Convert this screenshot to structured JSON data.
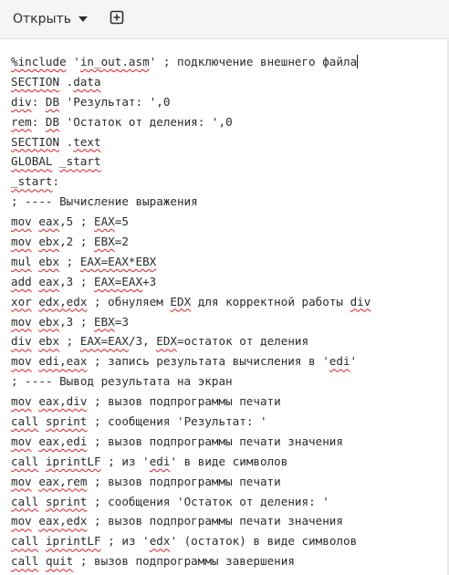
{
  "header": {
    "open_label": "Открыть",
    "open_icon": "chevron-down-icon",
    "new_tab_icon": "new-tab-plus-icon"
  },
  "editor": {
    "lines": [
      [
        {
          "t": "%include",
          "s": 1
        },
        {
          "t": " '"
        },
        {
          "t": "in_out.asm",
          "s": 1
        },
        {
          "t": "' ; подключение внешнего файла"
        }
      ],
      [
        {
          "t": "SECTION",
          "s": 1
        },
        {
          "t": " ."
        },
        {
          "t": "data",
          "s": 1
        }
      ],
      [
        {
          "t": "div",
          "s": 1
        },
        {
          "t": ": "
        },
        {
          "t": "DB",
          "s": 1
        },
        {
          "t": " 'Результат: ',0"
        }
      ],
      [
        {
          "t": "rem",
          "s": 1
        },
        {
          "t": ": "
        },
        {
          "t": "DB",
          "s": 1
        },
        {
          "t": " 'Остаток от деления: ',0"
        }
      ],
      [
        {
          "t": "SECTION",
          "s": 1
        },
        {
          "t": " ."
        },
        {
          "t": "text",
          "s": 1
        }
      ],
      [
        {
          "t": "GLOBAL",
          "s": 1
        },
        {
          "t": " "
        },
        {
          "t": "_start",
          "s": 1
        }
      ],
      [
        {
          "t": "_start",
          "s": 1
        },
        {
          "t": ":"
        }
      ],
      [
        {
          "t": "; ---- Вычисление выражения"
        }
      ],
      [
        {
          "t": "mov",
          "s": 1
        },
        {
          "t": " "
        },
        {
          "t": "eax",
          "s": 1
        },
        {
          "t": ",5 ; "
        },
        {
          "t": "EAX",
          "s": 1
        },
        {
          "t": "=5"
        }
      ],
      [
        {
          "t": "mov",
          "s": 1
        },
        {
          "t": " "
        },
        {
          "t": "ebx",
          "s": 1
        },
        {
          "t": ",2 ; "
        },
        {
          "t": "EBX",
          "s": 1
        },
        {
          "t": "=2"
        }
      ],
      [
        {
          "t": "mul",
          "s": 1
        },
        {
          "t": " "
        },
        {
          "t": "ebx",
          "s": 1
        },
        {
          "t": " ; "
        },
        {
          "t": "EAX=EAX*EBX",
          "s": 1
        }
      ],
      [
        {
          "t": "add",
          "s": 1
        },
        {
          "t": " "
        },
        {
          "t": "eax",
          "s": 1
        },
        {
          "t": ",3 ; "
        },
        {
          "t": "EAX=EAX",
          "s": 1
        },
        {
          "t": "+3"
        }
      ],
      [
        {
          "t": "xor",
          "s": 1
        },
        {
          "t": " "
        },
        {
          "t": "edx,edx",
          "s": 1
        },
        {
          "t": " ; обнуляем "
        },
        {
          "t": "EDX",
          "s": 1
        },
        {
          "t": " для корректной работы "
        },
        {
          "t": "div",
          "s": 1
        }
      ],
      [
        {
          "t": "mov",
          "s": 1
        },
        {
          "t": " "
        },
        {
          "t": "ebx",
          "s": 1
        },
        {
          "t": ",3 ; "
        },
        {
          "t": "EBX",
          "s": 1
        },
        {
          "t": "=3"
        }
      ],
      [
        {
          "t": "div",
          "s": 1
        },
        {
          "t": " "
        },
        {
          "t": "ebx",
          "s": 1
        },
        {
          "t": " ; "
        },
        {
          "t": "EAX=EAX",
          "s": 1
        },
        {
          "t": "/3, "
        },
        {
          "t": "EDX",
          "s": 1
        },
        {
          "t": "=остаток от деления"
        }
      ],
      [
        {
          "t": "mov",
          "s": 1
        },
        {
          "t": " "
        },
        {
          "t": "edi,eax",
          "s": 1
        },
        {
          "t": " ; запись результата вычисления в '"
        },
        {
          "t": "edi",
          "s": 1
        },
        {
          "t": "'"
        }
      ],
      [
        {
          "t": "; ---- Вывод результата на экран"
        }
      ],
      [
        {
          "t": "mov",
          "s": 1
        },
        {
          "t": " "
        },
        {
          "t": "eax,div",
          "s": 1
        },
        {
          "t": " ; вызов подпрограммы печати"
        }
      ],
      [
        {
          "t": "call",
          "s": 1
        },
        {
          "t": " "
        },
        {
          "t": "sprint",
          "s": 1
        },
        {
          "t": " ; сообщения 'Результат: '"
        }
      ],
      [
        {
          "t": "mov",
          "s": 1
        },
        {
          "t": " "
        },
        {
          "t": "eax,edi",
          "s": 1
        },
        {
          "t": " ; вызов подпрограммы печати значения"
        }
      ],
      [
        {
          "t": "call",
          "s": 1
        },
        {
          "t": " "
        },
        {
          "t": "iprintLF",
          "s": 1
        },
        {
          "t": " ; из '"
        },
        {
          "t": "edi",
          "s": 1
        },
        {
          "t": "' в виде символов"
        }
      ],
      [
        {
          "t": "mov",
          "s": 1
        },
        {
          "t": " "
        },
        {
          "t": "eax,rem",
          "s": 1
        },
        {
          "t": " ; вызов подпрограммы печати"
        }
      ],
      [
        {
          "t": "call",
          "s": 1
        },
        {
          "t": " "
        },
        {
          "t": "sprint",
          "s": 1
        },
        {
          "t": " ; сообщения 'Остаток от деления: '"
        }
      ],
      [
        {
          "t": "mov",
          "s": 1
        },
        {
          "t": " "
        },
        {
          "t": "eax,edx",
          "s": 1
        },
        {
          "t": " ; вызов подпрограммы печати значения"
        }
      ],
      [
        {
          "t": "call",
          "s": 1
        },
        {
          "t": " "
        },
        {
          "t": "iprintLF",
          "s": 1
        },
        {
          "t": " ; из '"
        },
        {
          "t": "edx",
          "s": 1
        },
        {
          "t": "' (остаток) в виде символов"
        }
      ],
      [
        {
          "t": "call",
          "s": 1
        },
        {
          "t": " "
        },
        {
          "t": "quit",
          "s": 1
        },
        {
          "t": " ; вызов подпрограммы завершения"
        }
      ]
    ]
  }
}
